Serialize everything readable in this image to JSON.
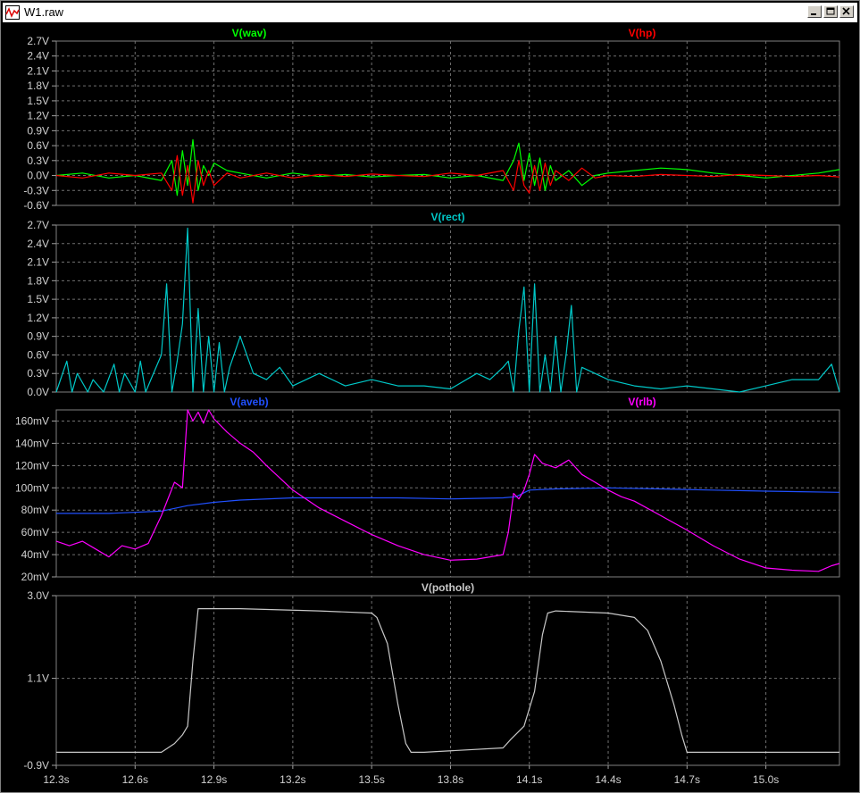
{
  "window": {
    "title": "W1.raw"
  },
  "colors": {
    "wav": "#00ff00",
    "hp": "#ff0000",
    "rect": "#00c8c8",
    "aveb": "#2050ff",
    "rlb": "#ff00ff",
    "pothole": "#c8c8c8"
  },
  "chart_data": [
    {
      "type": "line",
      "series": [
        {
          "name": "V(wav)",
          "color": "#00ff00",
          "x": [
            12.3,
            12.4,
            12.5,
            12.6,
            12.7,
            12.74,
            12.76,
            12.78,
            12.8,
            12.82,
            12.84,
            12.86,
            12.88,
            12.9,
            12.95,
            13.0,
            13.1,
            13.2,
            13.3,
            13.4,
            13.5,
            13.6,
            13.7,
            13.8,
            13.9,
            14.0,
            14.04,
            14.06,
            14.08,
            14.1,
            14.12,
            14.14,
            14.16,
            14.18,
            14.2,
            14.25,
            14.3,
            14.35,
            14.4,
            14.5,
            14.6,
            14.7,
            14.8,
            14.9,
            15.0,
            15.1,
            15.2,
            15.28
          ],
          "y": [
            0.0,
            0.05,
            -0.05,
            0.0,
            -0.1,
            0.3,
            -0.4,
            0.5,
            -0.2,
            0.72,
            -0.3,
            0.2,
            0.0,
            0.25,
            0.1,
            0.05,
            -0.05,
            0.05,
            -0.02,
            0.02,
            -0.03,
            0.0,
            0.02,
            -0.05,
            0.0,
            -0.1,
            0.3,
            0.65,
            -0.1,
            0.45,
            -0.2,
            0.35,
            -0.3,
            0.2,
            -0.1,
            0.1,
            -0.2,
            0.0,
            0.05,
            0.1,
            0.15,
            0.12,
            0.05,
            0.0,
            -0.05,
            0.0,
            0.05,
            0.12
          ]
        },
        {
          "name": "V(hp)",
          "color": "#ff0000",
          "x": [
            12.3,
            12.4,
            12.5,
            12.6,
            12.7,
            12.74,
            12.76,
            12.78,
            12.8,
            12.82,
            12.84,
            12.86,
            12.88,
            12.9,
            12.95,
            13.0,
            13.1,
            13.2,
            13.3,
            13.4,
            13.5,
            13.6,
            13.7,
            13.8,
            13.9,
            14.0,
            14.04,
            14.06,
            14.08,
            14.1,
            14.12,
            14.14,
            14.16,
            14.18,
            14.2,
            14.25,
            14.3,
            14.35,
            14.4,
            14.5,
            14.6,
            14.7,
            14.8,
            14.9,
            15.0,
            15.1,
            15.2,
            15.28
          ],
          "y": [
            0.0,
            -0.05,
            0.05,
            0.0,
            0.05,
            -0.3,
            0.4,
            -0.4,
            0.2,
            -0.55,
            0.3,
            -0.2,
            0.1,
            -0.2,
            0.05,
            -0.05,
            0.05,
            -0.05,
            0.02,
            -0.02,
            0.03,
            0.0,
            -0.02,
            0.05,
            0.0,
            0.1,
            -0.3,
            0.3,
            -0.2,
            -0.35,
            0.2,
            -0.3,
            0.25,
            -0.2,
            0.1,
            -0.1,
            0.15,
            -0.05,
            0.0,
            -0.02,
            0.02,
            0.0,
            -0.02,
            0.02,
            0.0,
            -0.02,
            0.0,
            -0.03
          ]
        }
      ],
      "ylim": [
        -0.6,
        2.7
      ],
      "yticks": [
        "2.7V",
        "2.4V",
        "2.1V",
        "1.8V",
        "1.5V",
        "1.2V",
        "0.9V",
        "0.6V",
        "0.3V",
        "0.0V",
        "-0.3V",
        "-0.6V"
      ],
      "yticks_val": [
        2.7,
        2.4,
        2.1,
        1.8,
        1.5,
        1.2,
        0.9,
        0.6,
        0.3,
        0.0,
        -0.3,
        -0.6
      ]
    },
    {
      "type": "line",
      "series": [
        {
          "name": "V(rect)",
          "color": "#00c8c8",
          "x": [
            12.3,
            12.34,
            12.36,
            12.38,
            12.42,
            12.44,
            12.48,
            12.52,
            12.54,
            12.56,
            12.6,
            12.62,
            12.64,
            12.66,
            12.7,
            12.72,
            12.74,
            12.76,
            12.78,
            12.8,
            12.82,
            12.84,
            12.86,
            12.88,
            12.9,
            12.92,
            12.94,
            12.96,
            13.0,
            13.05,
            13.1,
            13.15,
            13.2,
            13.3,
            13.4,
            13.5,
            13.6,
            13.7,
            13.8,
            13.9,
            13.95,
            14.0,
            14.02,
            14.04,
            14.06,
            14.08,
            14.1,
            14.12,
            14.14,
            14.16,
            14.18,
            14.2,
            14.22,
            14.24,
            14.26,
            14.28,
            14.3,
            14.35,
            14.4,
            14.5,
            14.6,
            14.7,
            14.8,
            14.9,
            15.0,
            15.1,
            15.2,
            15.25,
            15.28
          ],
          "y": [
            0.0,
            0.5,
            0.0,
            0.3,
            0.0,
            0.2,
            0.0,
            0.45,
            0.0,
            0.3,
            0.0,
            0.5,
            0.0,
            0.2,
            0.6,
            1.75,
            0.0,
            0.5,
            1.1,
            2.65,
            0.0,
            1.35,
            0.0,
            0.9,
            0.0,
            0.8,
            0.0,
            0.4,
            0.9,
            0.3,
            0.2,
            0.4,
            0.1,
            0.3,
            0.1,
            0.2,
            0.1,
            0.1,
            0.05,
            0.3,
            0.2,
            0.4,
            0.5,
            0.0,
            1.0,
            1.7,
            0.0,
            1.75,
            0.0,
            0.6,
            0.0,
            0.9,
            0.0,
            0.6,
            1.4,
            0.0,
            0.4,
            0.3,
            0.2,
            0.1,
            0.05,
            0.1,
            0.05,
            0.0,
            0.1,
            0.2,
            0.2,
            0.45,
            0.0
          ]
        }
      ],
      "ylim": [
        0.0,
        2.7
      ],
      "yticks": [
        "2.7V",
        "2.4V",
        "2.1V",
        "1.8V",
        "1.5V",
        "1.2V",
        "0.9V",
        "0.6V",
        "0.3V",
        "0.0V"
      ],
      "yticks_val": [
        2.7,
        2.4,
        2.1,
        1.8,
        1.5,
        1.2,
        0.9,
        0.6,
        0.3,
        0.0
      ]
    },
    {
      "type": "line",
      "series": [
        {
          "name": "V(aveb)",
          "color": "#2050ff",
          "x": [
            12.3,
            12.5,
            12.7,
            12.8,
            12.9,
            13.0,
            13.2,
            13.4,
            13.6,
            13.8,
            14.0,
            14.05,
            14.1,
            14.2,
            14.4,
            14.6,
            14.8,
            15.0,
            15.28
          ],
          "y": [
            77,
            77,
            79,
            84,
            87,
            89,
            91,
            91,
            91,
            90,
            91,
            92,
            98,
            99,
            100,
            99,
            98,
            97,
            96
          ]
        },
        {
          "name": "V(rlb)",
          "color": "#ff00ff",
          "x": [
            12.3,
            12.35,
            12.4,
            12.45,
            12.5,
            12.55,
            12.6,
            12.65,
            12.7,
            12.75,
            12.78,
            12.8,
            12.82,
            12.84,
            12.86,
            12.88,
            12.9,
            12.95,
            13.0,
            13.05,
            13.1,
            13.2,
            13.3,
            13.4,
            13.5,
            13.6,
            13.7,
            13.8,
            13.9,
            14.0,
            14.02,
            14.04,
            14.06,
            14.08,
            14.1,
            14.12,
            14.15,
            14.2,
            14.25,
            14.3,
            14.35,
            14.4,
            14.45,
            14.5,
            14.6,
            14.7,
            14.8,
            14.9,
            15.0,
            15.1,
            15.2,
            15.25,
            15.28
          ],
          "y": [
            52,
            48,
            52,
            45,
            38,
            48,
            45,
            50,
            75,
            105,
            100,
            170,
            160,
            168,
            158,
            170,
            162,
            150,
            140,
            132,
            120,
            98,
            82,
            70,
            58,
            48,
            40,
            35,
            36,
            40,
            60,
            95,
            90,
            98,
            112,
            130,
            122,
            118,
            125,
            112,
            105,
            98,
            92,
            88,
            75,
            62,
            48,
            36,
            28,
            26,
            25,
            30,
            32
          ]
        }
      ],
      "ylim": [
        20,
        170
      ],
      "yticks": [
        "160mV",
        "140mV",
        "120mV",
        "100mV",
        "80mV",
        "60mV",
        "40mV",
        "20mV"
      ],
      "yticks_val": [
        160,
        140,
        120,
        100,
        80,
        60,
        40,
        20
      ]
    },
    {
      "type": "line",
      "series": [
        {
          "name": "V(pothole)",
          "color": "#c8c8c8",
          "x": [
            12.3,
            12.5,
            12.7,
            12.75,
            12.78,
            12.8,
            12.82,
            12.84,
            13.0,
            13.3,
            13.5,
            13.52,
            13.56,
            13.6,
            13.63,
            13.65,
            13.7,
            14.0,
            14.03,
            14.08,
            14.12,
            14.15,
            14.17,
            14.2,
            14.4,
            14.5,
            14.55,
            14.6,
            14.65,
            14.68,
            14.7,
            14.8,
            15.0,
            15.28
          ],
          "y": [
            -0.6,
            -0.6,
            -0.6,
            -0.4,
            -0.2,
            0.0,
            1.5,
            2.7,
            2.7,
            2.65,
            2.6,
            2.5,
            1.9,
            0.5,
            -0.4,
            -0.6,
            -0.6,
            -0.5,
            -0.3,
            0.0,
            0.8,
            2.1,
            2.6,
            2.65,
            2.6,
            2.5,
            2.2,
            1.5,
            0.5,
            -0.2,
            -0.6,
            -0.6,
            -0.6,
            -0.6
          ]
        }
      ],
      "ylim": [
        -0.9,
        3.0
      ],
      "yticks": [
        "3.0V",
        "1.1V",
        "-0.9V"
      ],
      "yticks_val": [
        3.0,
        1.1,
        -0.9
      ]
    }
  ],
  "xaxis": {
    "range": [
      12.3,
      15.28
    ],
    "ticks": [
      "12.3s",
      "12.6s",
      "12.9s",
      "13.2s",
      "13.5s",
      "13.8s",
      "14.1s",
      "14.4s",
      "14.7s",
      "15.0s"
    ],
    "ticks_val": [
      12.3,
      12.6,
      12.9,
      13.2,
      13.5,
      13.8,
      14.1,
      14.4,
      14.7,
      15.0
    ]
  },
  "panel_titles": [
    [
      {
        "text": "V(wav)",
        "color": "#00ff00"
      },
      {
        "text": "V(hp)",
        "color": "#ff0000"
      }
    ],
    [
      {
        "text": "V(rect)",
        "color": "#00c8c8"
      }
    ],
    [
      {
        "text": "V(aveb)",
        "color": "#2050ff"
      },
      {
        "text": "V(rlb)",
        "color": "#ff00ff"
      }
    ],
    [
      {
        "text": "V(pothole)",
        "color": "#c8c8c8"
      }
    ]
  ]
}
